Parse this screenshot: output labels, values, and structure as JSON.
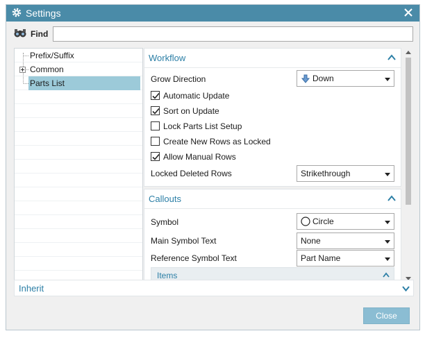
{
  "window": {
    "title": "Settings"
  },
  "find": {
    "label": "Find",
    "value": ""
  },
  "tree": {
    "items": [
      {
        "label": "Prefix/Suffix",
        "selected": false,
        "expandable": false
      },
      {
        "label": "Common",
        "selected": false,
        "expandable": true
      },
      {
        "label": "Parts List",
        "selected": true,
        "expandable": false
      }
    ]
  },
  "workflow": {
    "title": "Workflow",
    "grow_direction": {
      "label": "Grow Direction",
      "value": "Down",
      "icon": "down-arrow-icon"
    },
    "checkboxes": [
      {
        "label": "Automatic Update",
        "checked": true
      },
      {
        "label": "Sort on Update",
        "checked": true
      },
      {
        "label": "Lock Parts List Setup",
        "checked": false
      },
      {
        "label": "Create New Rows as Locked",
        "checked": false
      },
      {
        "label": "Allow Manual Rows",
        "checked": true
      }
    ],
    "locked_deleted_rows": {
      "label": "Locked Deleted Rows",
      "value": "Strikethrough"
    }
  },
  "callouts": {
    "title": "Callouts",
    "symbol": {
      "label": "Symbol",
      "value": "Circle",
      "icon": "circle-icon"
    },
    "main_symbol_text": {
      "label": "Main Symbol Text",
      "value": "None"
    },
    "reference_symbol_text": {
      "label": "Reference Symbol Text",
      "value": "Part Name"
    },
    "items_group": {
      "title": "Items"
    }
  },
  "inherit": {
    "title": "Inherit"
  },
  "footer": {
    "close_label": "Close"
  },
  "colors": {
    "titlebar": "#4a8ba8",
    "accent_text": "#2c7fa6",
    "selection": "#9ccad9",
    "close_button": "#8bbdd3"
  }
}
